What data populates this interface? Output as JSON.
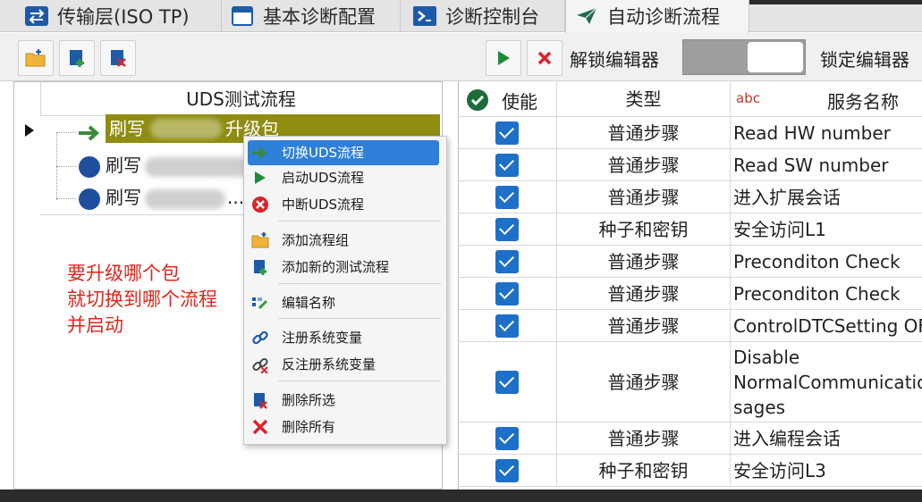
{
  "tabs": [
    {
      "label": "传输层(ISO TP)",
      "icon": "swap-arrows-icon"
    },
    {
      "label": "基本诊断配置",
      "icon": "window-icon"
    },
    {
      "label": "诊断控制台",
      "icon": "console-icon"
    },
    {
      "label": "自动诊断流程",
      "icon": "paper-plane-icon"
    }
  ],
  "toolbar": {
    "unlock_label": "解锁编辑器",
    "lock_label": "锁定编辑器"
  },
  "tree": {
    "header": "UDS测试流程",
    "rows": [
      {
        "prefix": "刷写",
        "suffix": "升级包"
      },
      {
        "prefix": "刷写",
        "suffix": ""
      },
      {
        "prefix": "刷写",
        "suffix": "..."
      }
    ]
  },
  "annotation": {
    "line1": "要升级哪个包",
    "line2": "就切换到哪个流程",
    "line3": "并启动"
  },
  "context_menu": {
    "items": [
      {
        "label": "切换UDS流程",
        "icon": "green-arrow-icon"
      },
      {
        "label": "启动UDS流程",
        "icon": "play-icon"
      },
      {
        "label": "中断UDS流程",
        "icon": "stop-circle-icon"
      },
      {
        "label": "添加流程组",
        "icon": "folder-add-icon"
      },
      {
        "label": "添加新的测试流程",
        "icon": "add-file-icon"
      },
      {
        "label": "编辑名称",
        "icon": "edit-name-icon"
      },
      {
        "label": "注册系统变量",
        "icon": "link-icon"
      },
      {
        "label": "反注册系统变量",
        "icon": "unlink-icon"
      },
      {
        "label": "删除所选",
        "icon": "delete-selected-icon"
      },
      {
        "label": "删除所有",
        "icon": "delete-all-icon"
      }
    ]
  },
  "grid": {
    "headers": {
      "enabled": "使能",
      "type": "类型",
      "name_prefix": "abc",
      "name": "服务名称"
    },
    "rows": [
      {
        "type": "普通步骤",
        "name": "Read HW number"
      },
      {
        "type": "普通步骤",
        "name": "Read SW number"
      },
      {
        "type": "普通步骤",
        "name": "进入扩展会话"
      },
      {
        "type": "种子和密钥",
        "name": "安全访问L1"
      },
      {
        "type": "普通步骤",
        "name": "Preconditon Check"
      },
      {
        "type": "普通步骤",
        "name": "Preconditon Check"
      },
      {
        "type": "普通步骤",
        "name": "ControlDTCSetting OFF"
      },
      {
        "type": "普通步骤",
        "name_lines": [
          "Disable",
          "NormalCommunication",
          "sages"
        ]
      },
      {
        "type": "普通步骤",
        "name": "进入编程会话"
      },
      {
        "type": "种子和密钥",
        "name": "安全访问L3"
      }
    ]
  }
}
